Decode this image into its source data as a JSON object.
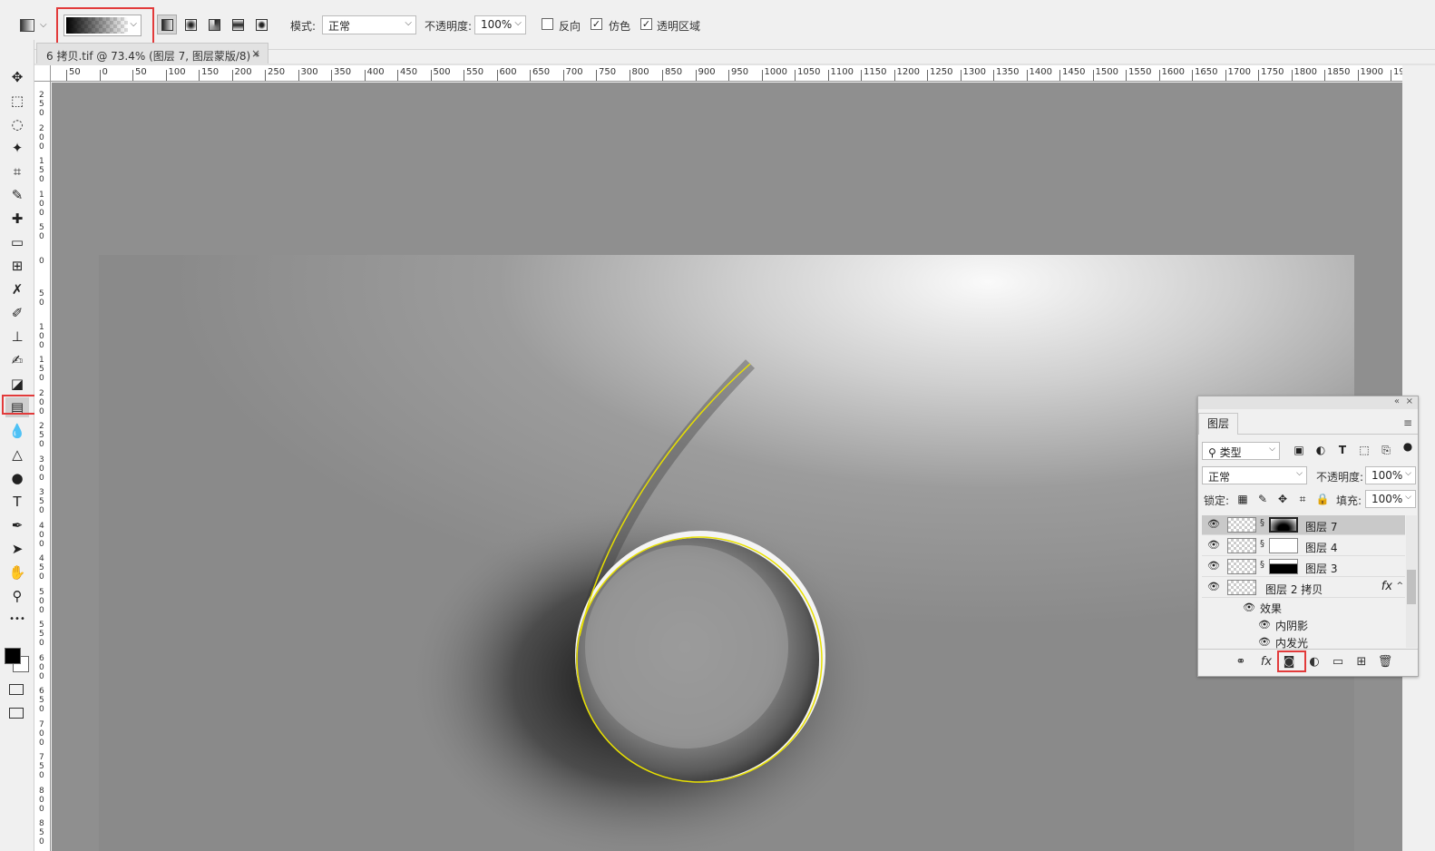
{
  "options_bar": {
    "tool_preset_icon": "gradient-tool-icon",
    "gradient_picker": "black-to-transparent",
    "gradient_types": [
      "linear",
      "radial",
      "angle",
      "reflected",
      "diamond"
    ],
    "mode_label": "模式:",
    "mode_value": "正常",
    "opacity_label": "不透明度:",
    "opacity_value": "100%",
    "reverse_label": "反向",
    "reverse_checked": false,
    "dither_label": "仿色",
    "dither_checked": true,
    "transparency_label": "透明区域",
    "transparency_checked": true,
    "checkmark": "✓",
    "caret": "⌵"
  },
  "document_tab": {
    "title": "6 拷贝.tif @ 73.4% (图层 7, 图层蒙版/8) *",
    "close": "×"
  },
  "ruler": {
    "h_labels": [
      "50",
      "0",
      "50",
      "100",
      "150",
      "200",
      "250",
      "300",
      "350",
      "400",
      "450",
      "500",
      "550",
      "600",
      "650",
      "700",
      "750",
      "800",
      "850",
      "900",
      "950",
      "1000",
      "1050",
      "1100",
      "1150",
      "1200",
      "1250",
      "1300",
      "1350",
      "1400",
      "1450",
      "1500",
      "1550",
      "1600",
      "1650",
      "1700",
      "1750",
      "1800",
      "1850",
      "1900",
      "19"
    ],
    "v_labels": [
      "250",
      "200",
      "150",
      "100",
      "50",
      "0",
      "50",
      "100",
      "150",
      "200",
      "250",
      "300",
      "350",
      "400",
      "450",
      "500",
      "550",
      "600",
      "650",
      "700",
      "750",
      "800",
      "850"
    ]
  },
  "toolbar": {
    "tools": [
      {
        "name": "move-tool-icon",
        "glyph": "✥"
      },
      {
        "name": "marquee-tool-icon",
        "glyph": "⬚"
      },
      {
        "name": "lasso-tool-icon",
        "glyph": "◌"
      },
      {
        "name": "magic-wand-tool-icon",
        "glyph": "✦"
      },
      {
        "name": "crop-tool-icon",
        "glyph": "⌗"
      },
      {
        "name": "eyedropper-tool-icon",
        "glyph": "✎"
      },
      {
        "name": "healing-brush-tool-icon",
        "glyph": "✚"
      },
      {
        "name": "patch-tool-icon",
        "glyph": "▭"
      },
      {
        "name": "frame-tool-icon",
        "glyph": "⊞"
      },
      {
        "name": "content-aware-move-tool-icon",
        "glyph": "✗"
      },
      {
        "name": "brush-tool-icon",
        "glyph": "✐"
      },
      {
        "name": "clone-stamp-tool-icon",
        "glyph": "⊥"
      },
      {
        "name": "history-brush-tool-icon",
        "glyph": "✍"
      },
      {
        "name": "eraser-tool-icon",
        "glyph": "◪"
      },
      {
        "name": "gradient-tool-icon",
        "glyph": "▤"
      },
      {
        "name": "blur-tool-icon",
        "glyph": "💧"
      },
      {
        "name": "sharpen-tool-icon",
        "glyph": "△"
      },
      {
        "name": "dodge-tool-icon",
        "glyph": "●"
      },
      {
        "name": "type-tool-icon",
        "glyph": "T"
      },
      {
        "name": "pen-tool-icon",
        "glyph": "✒"
      },
      {
        "name": "path-selection-tool-icon",
        "glyph": "➤"
      },
      {
        "name": "hand-tool-icon",
        "glyph": "✋"
      },
      {
        "name": "zoom-tool-icon",
        "glyph": "⚲"
      },
      {
        "name": "more-tools-icon",
        "glyph": "•••"
      }
    ],
    "active_tool": "gradient-tool-icon"
  },
  "layers_panel": {
    "tab": "图层",
    "filter_kind": "类型",
    "blend_mode": "正常",
    "opacity_label": "不透明度:",
    "opacity_value": "100%",
    "lock_label": "锁定:",
    "fill_label": "填充:",
    "fill_value": "100%",
    "layers": [
      {
        "name": "图层 7",
        "selected": true,
        "mask": "radial-black",
        "fx": false
      },
      {
        "name": "图层 4",
        "selected": false,
        "mask": "white",
        "fx": false
      },
      {
        "name": "图层 3",
        "selected": false,
        "mask": "black-top",
        "fx": false
      },
      {
        "name": "图层 2 拷贝",
        "selected": false,
        "mask": null,
        "fx": true
      }
    ],
    "effects_label": "效果",
    "effects": [
      "内阴影",
      "内发光"
    ],
    "bottom_icons": [
      "link-icon",
      "fx-icon",
      "add-mask-icon",
      "adjustment-icon",
      "group-icon",
      "new-layer-icon",
      "trash-icon"
    ]
  },
  "colors": {
    "highlight_box": "#e23b3b",
    "path_stroke": "#e8e000"
  }
}
